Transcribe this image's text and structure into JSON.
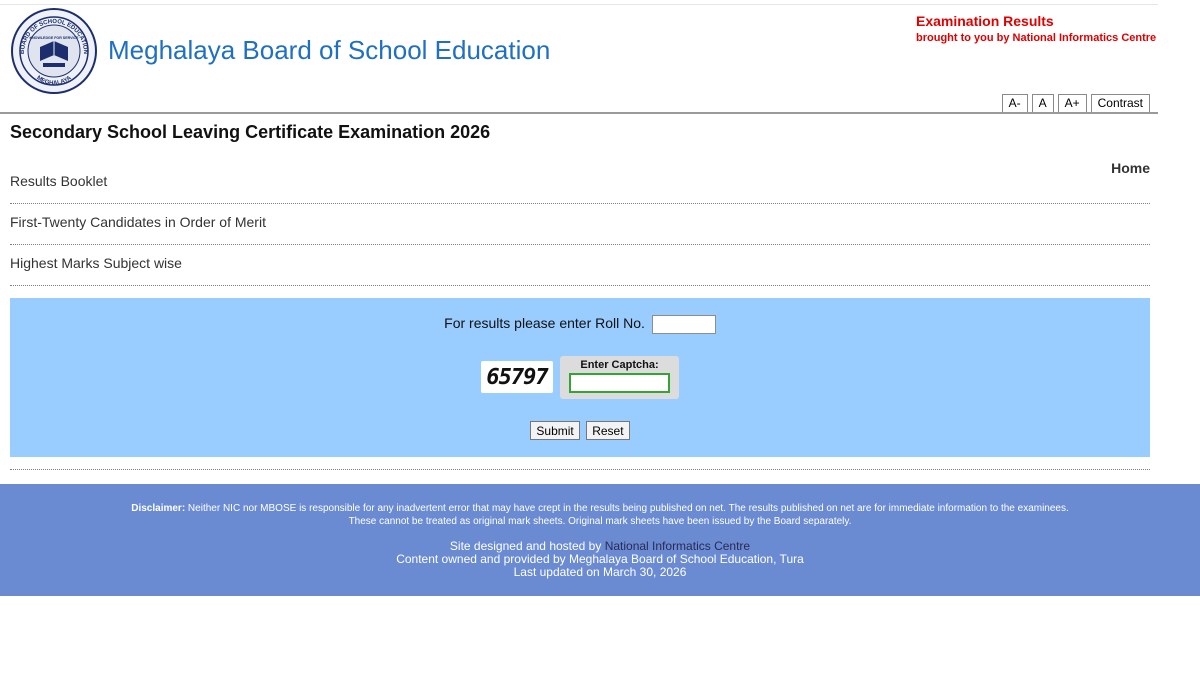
{
  "header": {
    "board_name": "Meghalaya Board of School Education",
    "logo": {
      "emblem_name": "board-emblem",
      "ring_top_text": "BOARD OF SCHOOL EDUCATION",
      "motto": "KNOWLEDGE FOR SERVICE",
      "bottom_text": "MEGHALAYA"
    },
    "exam_results_label": "Examination Results",
    "brought_by": "brought to you by National Informatics Centre",
    "font_controls": [
      "A-",
      "A",
      "A+",
      "Contrast"
    ]
  },
  "page_title": "Secondary School Leaving Certificate Examination 2026",
  "home_link": "Home",
  "nav_links": [
    "Results Booklet",
    "First-Twenty Candidates in Order of Merit",
    "Highest Marks Subject wise"
  ],
  "result_form": {
    "roll_prompt": "For results please enter Roll No.",
    "roll_value": "",
    "captcha_code": "65797",
    "captcha_label": "Enter Captcha:",
    "captcha_value": "",
    "submit_label": "Submit",
    "reset_label": "Reset"
  },
  "footer": {
    "disclaimer_label": "Disclaimer:",
    "disclaimer_line1": " Neither NIC nor MBOSE is responsible for any inadvertent error that may have crept in the results being published on net. The results published on net are for immediate information to the examinees.",
    "disclaimer_line2": "These cannot be treated as original mark sheets. Original mark sheets have been issued by the Board separately.",
    "hosted_prefix": "Site designed and hosted by ",
    "hosted_link": "National Informatics Centre",
    "content_owner": "Content owned and provided by Meghalaya Board of School Education, Tura",
    "last_updated": "Last updated on March 30, 2026"
  },
  "colors": {
    "title_blue": "#1f6fc2",
    "alert_red": "#e00000",
    "form_background": "#99ccff",
    "footer_background": "#6a8bd2"
  }
}
